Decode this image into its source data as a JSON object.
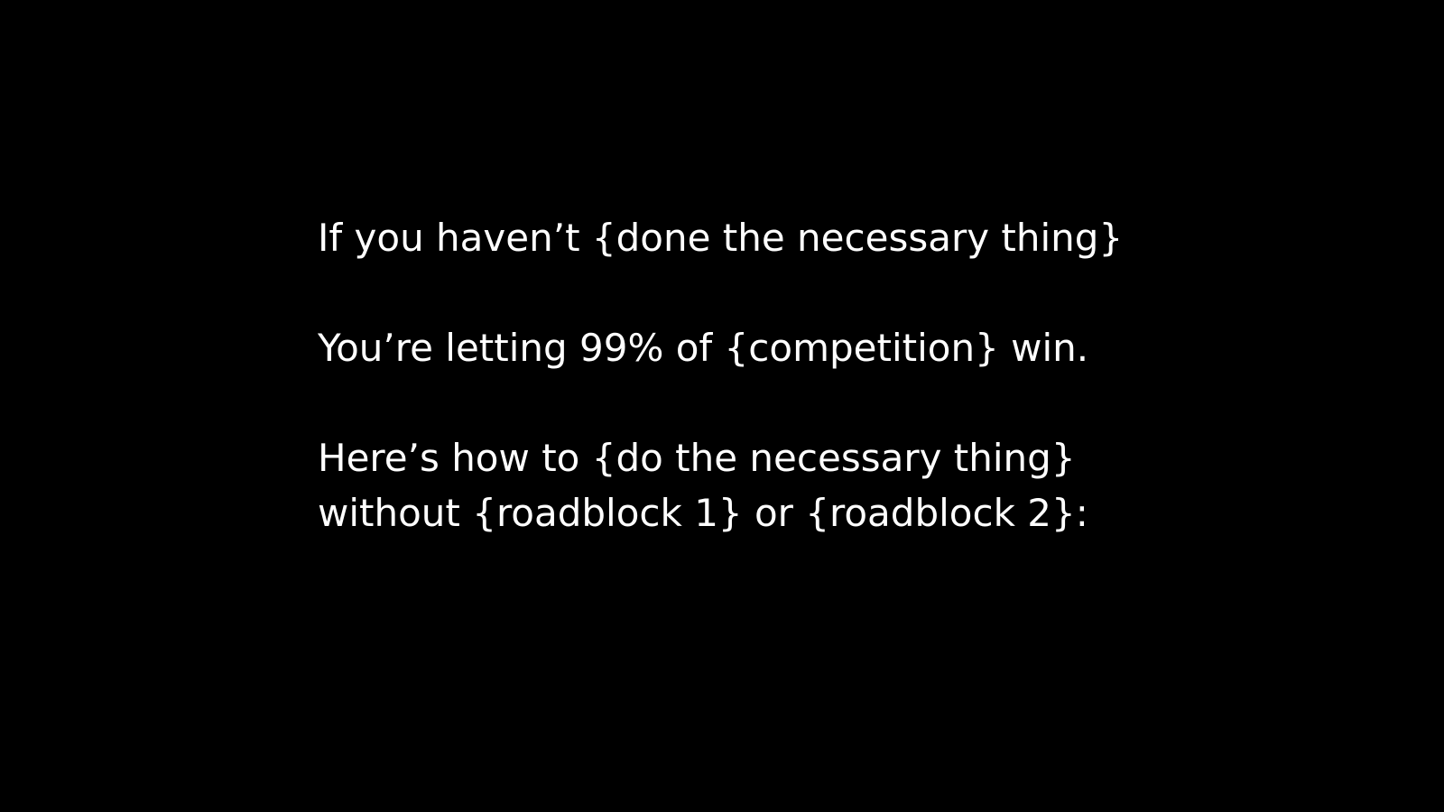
{
  "slide": {
    "background_color": "#000000",
    "text_color": "#ffffff",
    "lines": [
      "If you haven’t {done the necessary thing}",
      "You’re letting 99% of {competition} win.",
      "Here’s how to {do the necessary thing}",
      "without {roadblock 1} or {roadblock 2}:"
    ]
  }
}
